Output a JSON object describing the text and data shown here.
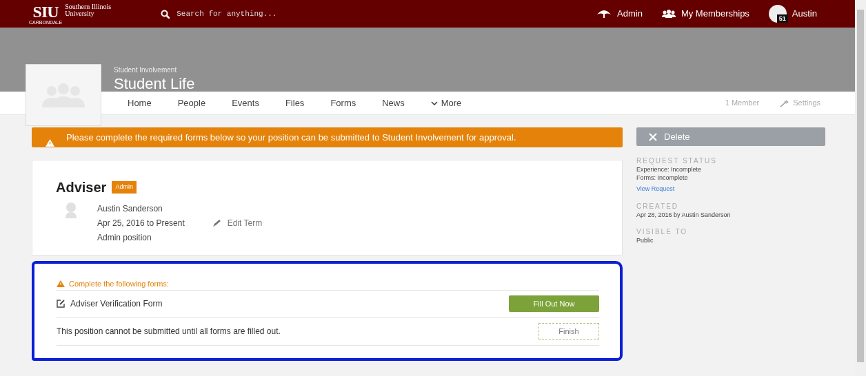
{
  "topbar": {
    "logo": {
      "mark": "SIU",
      "name_line_1": "Southern Illinois",
      "name_line_2": "University",
      "campus": "CARBONDALE"
    },
    "search": {
      "placeholder": "Search for anything..."
    },
    "links": [
      {
        "kind": "admin",
        "label": "Admin"
      },
      {
        "kind": "memberships",
        "label": "My Memberships"
      },
      {
        "kind": "user",
        "label": "Austin",
        "badge": "51"
      }
    ]
  },
  "group": {
    "parent": "Student Involvement",
    "title": "Student Life"
  },
  "tabs": [
    {
      "label": "Home",
      "kind": "plain"
    },
    {
      "label": "People",
      "kind": "plain"
    },
    {
      "label": "Events",
      "kind": "plain"
    },
    {
      "label": "Files",
      "kind": "plain"
    },
    {
      "label": "Forms",
      "kind": "plain"
    },
    {
      "label": "News",
      "kind": "plain"
    },
    {
      "label": "More",
      "kind": "dropdown"
    }
  ],
  "tab_right": {
    "members": "1 Member",
    "settings": "Settings"
  },
  "alert": "Please complete the required forms below so your position can be submitted to Student Involvement for approval.",
  "position": {
    "title": "Adviser",
    "badge": "Admin",
    "person": "Austin Sanderson",
    "term": "Apr 25, 2016 to Present",
    "edit": "Edit Term",
    "description": "Admin position"
  },
  "forms": {
    "heading": "Complete the following forms:",
    "items": [
      {
        "name": "Adviser Verification Form",
        "button": "Fill Out Now"
      }
    ],
    "message": "This position cannot be submitted until all forms are filled out.",
    "finish": "Finish"
  },
  "sidebar": {
    "delete": "Delete",
    "sections": [
      {
        "heading": "REQUEST STATUS",
        "lines": [
          {
            "kind": "text",
            "text": "Experience: Incomplete"
          },
          {
            "kind": "text",
            "text": "Forms: Incomplete"
          },
          {
            "kind": "link",
            "text": "View Request"
          }
        ]
      },
      {
        "heading": "CREATED",
        "lines": [
          {
            "kind": "text",
            "text": "Apr 28, 2016 by Austin Sanderson"
          }
        ]
      },
      {
        "heading": "VISIBLE TO",
        "lines": [
          {
            "kind": "text",
            "text": "Public"
          }
        ]
      }
    ]
  }
}
